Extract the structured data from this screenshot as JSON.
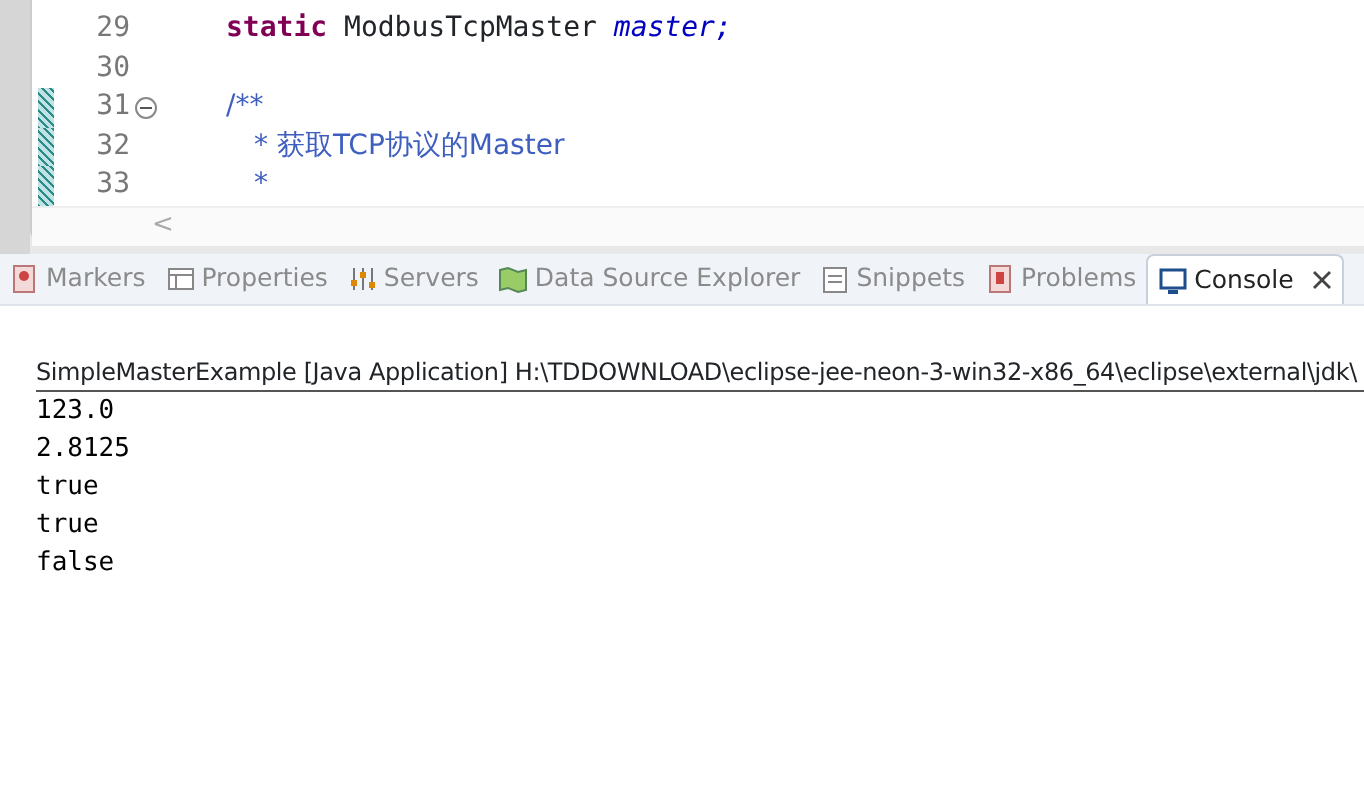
{
  "editor": {
    "lines": [
      {
        "number": "29",
        "kind": "field",
        "keyword": "static",
        "type": "ModbusTcpMaster",
        "name": "master;",
        "fold": false,
        "changed": false
      },
      {
        "number": "30",
        "kind": "blank",
        "fold": false,
        "changed": false
      },
      {
        "number": "31",
        "kind": "comment",
        "text": "/**",
        "fold": true,
        "changed": true
      },
      {
        "number": "32",
        "kind": "comment",
        "text": "* 获取TCP协议的Master",
        "fold": false,
        "changed": true
      },
      {
        "number": "33",
        "kind": "comment",
        "text": "*",
        "fold": false,
        "changed": true
      }
    ],
    "scroll_left": "<"
  },
  "tabs": [
    {
      "label": "Markers",
      "kind": "markers",
      "selected": false,
      "closable": false
    },
    {
      "label": "Properties",
      "kind": "properties",
      "selected": false,
      "closable": false
    },
    {
      "label": "Servers",
      "kind": "servers",
      "selected": false,
      "closable": false
    },
    {
      "label": "Data Source Explorer",
      "kind": "datasource",
      "selected": false,
      "closable": false
    },
    {
      "label": "Snippets",
      "kind": "snippets",
      "selected": false,
      "closable": false
    },
    {
      "label": "Problems",
      "kind": "problems",
      "selected": false,
      "closable": false
    },
    {
      "label": "Console",
      "kind": "console",
      "selected": true,
      "closable": true
    }
  ],
  "console": {
    "header": "SimpleMasterExample [Java Application] H:\\TDDOWNLOAD\\eclipse-jee-neon-3-win32-x86_64\\eclipse\\external\\jdk\\",
    "output": [
      "123.0",
      "2.8125",
      "true",
      "true",
      "false"
    ]
  }
}
